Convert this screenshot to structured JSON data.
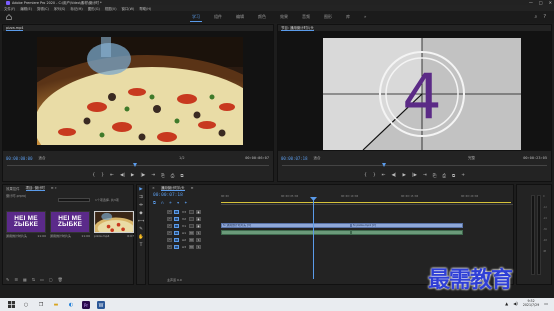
{
  "window": {
    "title": "Adobe Premiere Pro 2020 - C:\\用户\\Vdeo\\素材\\倒计时 *",
    "minimize": "—",
    "maximize": "□",
    "close": "✕"
  },
  "menu": [
    "文件(F)",
    "编辑(E)",
    "剪辑(C)",
    "序列(S)",
    "标记(M)",
    "图形(G)",
    "视图(V)",
    "窗口(W)",
    "帮助(H)"
  ],
  "workspaces": {
    "tabs": [
      {
        "label": "学习",
        "active": true
      },
      {
        "label": "组件"
      },
      {
        "label": "编辑"
      },
      {
        "label": "颜色"
      },
      {
        "label": "效果"
      },
      {
        "label": "音频"
      },
      {
        "label": "图形"
      },
      {
        "label": "库"
      }
    ],
    "more": "»"
  },
  "source_monitor": {
    "header": "pizza.mp4",
    "timecode": "00:00:00:00",
    "fit": "适合",
    "ratio": "1/2",
    "duration": "00:00:06:07"
  },
  "program_monitor": {
    "header": "节目: 通用倒计时片头",
    "timecode": "00:00:07:18",
    "fit": "适合",
    "ratio": "完整",
    "duration": "00:00:23:05",
    "countdown_number": "4"
  },
  "transport": {
    "buttons": [
      "{",
      "}",
      "⇤",
      "◀|",
      "▶",
      "|▶",
      "⇥",
      "⎘",
      "⎙",
      "⧉",
      "+"
    ]
  },
  "project_panel": {
    "tabs": [
      {
        "label": "效果控件"
      },
      {
        "label": "项目: 倒计时",
        "active": true
      }
    ],
    "more": "≡ »",
    "project_file": "倒计时.prproj",
    "search_placeholder": "",
    "item_count": "1个项选择, 共3项",
    "items": [
      {
        "name": "通用倒计时片头",
        "duration": "11:00",
        "line1": "HEI ME",
        "line2": "ZЫБКЕ"
      },
      {
        "name": "通用倒计时片头",
        "duration": "11:00",
        "line1": "HEI ME",
        "line2": "ZЫБКЕ"
      },
      {
        "name": "pizza.mp4",
        "duration": "6:07"
      }
    ]
  },
  "tools": [
    "▶",
    "⇉",
    "⇹",
    "◆",
    "⟷",
    "✎",
    "✋",
    "T"
  ],
  "timeline": {
    "header": "通用倒计时片头",
    "close": "×",
    "more": "≡",
    "timecode": "00:00:07:18",
    "ruler_labels": [
      "00:00",
      "00:00:05:00",
      "00:00:10:00",
      "00:00:15:00",
      "00:00:20:00"
    ],
    "tracks": [
      {
        "label": "V3",
        "clips": []
      },
      {
        "label": "V2",
        "clips": []
      },
      {
        "label": "V1",
        "clips": [
          {
            "label": "fx 通用倒计时片头 [V]",
            "type": "video"
          },
          {
            "label": "fx pizza.mp4 [V]",
            "type": "video"
          }
        ]
      },
      {
        "label": "A1",
        "clips": [
          {
            "label": "",
            "type": "audio"
          },
          {
            "label": "",
            "type": "audio"
          }
        ]
      },
      {
        "label": "A2",
        "clips": []
      },
      {
        "label": "A3",
        "clips": []
      }
    ],
    "master": "主声道",
    "master_value": "0.0"
  },
  "meter_scale": [
    "0",
    "-12",
    "-24",
    "-36",
    "-48",
    "dB"
  ],
  "watermark": "最需教育",
  "taskbar": {
    "apps": [
      "start",
      "search",
      "task-view",
      "file-explorer",
      "edge",
      "premiere",
      "word"
    ],
    "time": "9:32",
    "date": "2021/7/29"
  }
}
